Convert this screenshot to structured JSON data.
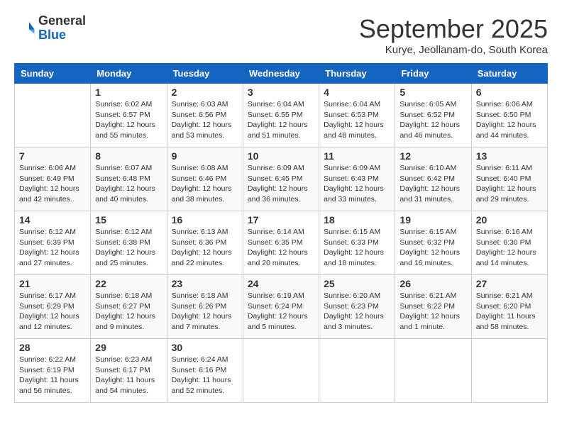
{
  "header": {
    "logo_general": "General",
    "logo_blue": "Blue",
    "month_title": "September 2025",
    "subtitle": "Kurye, Jeollanam-do, South Korea"
  },
  "days_of_week": [
    "Sunday",
    "Monday",
    "Tuesday",
    "Wednesday",
    "Thursday",
    "Friday",
    "Saturday"
  ],
  "weeks": [
    [
      {
        "day": "",
        "info": ""
      },
      {
        "day": "1",
        "info": "Sunrise: 6:02 AM\nSunset: 6:57 PM\nDaylight: 12 hours and 55 minutes."
      },
      {
        "day": "2",
        "info": "Sunrise: 6:03 AM\nSunset: 6:56 PM\nDaylight: 12 hours and 53 minutes."
      },
      {
        "day": "3",
        "info": "Sunrise: 6:04 AM\nSunset: 6:55 PM\nDaylight: 12 hours and 51 minutes."
      },
      {
        "day": "4",
        "info": "Sunrise: 6:04 AM\nSunset: 6:53 PM\nDaylight: 12 hours and 48 minutes."
      },
      {
        "day": "5",
        "info": "Sunrise: 6:05 AM\nSunset: 6:52 PM\nDaylight: 12 hours and 46 minutes."
      },
      {
        "day": "6",
        "info": "Sunrise: 6:06 AM\nSunset: 6:50 PM\nDaylight: 12 hours and 44 minutes."
      }
    ],
    [
      {
        "day": "7",
        "info": "Sunrise: 6:06 AM\nSunset: 6:49 PM\nDaylight: 12 hours and 42 minutes."
      },
      {
        "day": "8",
        "info": "Sunrise: 6:07 AM\nSunset: 6:48 PM\nDaylight: 12 hours and 40 minutes."
      },
      {
        "day": "9",
        "info": "Sunrise: 6:08 AM\nSunset: 6:46 PM\nDaylight: 12 hours and 38 minutes."
      },
      {
        "day": "10",
        "info": "Sunrise: 6:09 AM\nSunset: 6:45 PM\nDaylight: 12 hours and 36 minutes."
      },
      {
        "day": "11",
        "info": "Sunrise: 6:09 AM\nSunset: 6:43 PM\nDaylight: 12 hours and 33 minutes."
      },
      {
        "day": "12",
        "info": "Sunrise: 6:10 AM\nSunset: 6:42 PM\nDaylight: 12 hours and 31 minutes."
      },
      {
        "day": "13",
        "info": "Sunrise: 6:11 AM\nSunset: 6:40 PM\nDaylight: 12 hours and 29 minutes."
      }
    ],
    [
      {
        "day": "14",
        "info": "Sunrise: 6:12 AM\nSunset: 6:39 PM\nDaylight: 12 hours and 27 minutes."
      },
      {
        "day": "15",
        "info": "Sunrise: 6:12 AM\nSunset: 6:38 PM\nDaylight: 12 hours and 25 minutes."
      },
      {
        "day": "16",
        "info": "Sunrise: 6:13 AM\nSunset: 6:36 PM\nDaylight: 12 hours and 22 minutes."
      },
      {
        "day": "17",
        "info": "Sunrise: 6:14 AM\nSunset: 6:35 PM\nDaylight: 12 hours and 20 minutes."
      },
      {
        "day": "18",
        "info": "Sunrise: 6:15 AM\nSunset: 6:33 PM\nDaylight: 12 hours and 18 minutes."
      },
      {
        "day": "19",
        "info": "Sunrise: 6:15 AM\nSunset: 6:32 PM\nDaylight: 12 hours and 16 minutes."
      },
      {
        "day": "20",
        "info": "Sunrise: 6:16 AM\nSunset: 6:30 PM\nDaylight: 12 hours and 14 minutes."
      }
    ],
    [
      {
        "day": "21",
        "info": "Sunrise: 6:17 AM\nSunset: 6:29 PM\nDaylight: 12 hours and 12 minutes."
      },
      {
        "day": "22",
        "info": "Sunrise: 6:18 AM\nSunset: 6:27 PM\nDaylight: 12 hours and 9 minutes."
      },
      {
        "day": "23",
        "info": "Sunrise: 6:18 AM\nSunset: 6:26 PM\nDaylight: 12 hours and 7 minutes."
      },
      {
        "day": "24",
        "info": "Sunrise: 6:19 AM\nSunset: 6:24 PM\nDaylight: 12 hours and 5 minutes."
      },
      {
        "day": "25",
        "info": "Sunrise: 6:20 AM\nSunset: 6:23 PM\nDaylight: 12 hours and 3 minutes."
      },
      {
        "day": "26",
        "info": "Sunrise: 6:21 AM\nSunset: 6:22 PM\nDaylight: 12 hours and 1 minute."
      },
      {
        "day": "27",
        "info": "Sunrise: 6:21 AM\nSunset: 6:20 PM\nDaylight: 11 hours and 58 minutes."
      }
    ],
    [
      {
        "day": "28",
        "info": "Sunrise: 6:22 AM\nSunset: 6:19 PM\nDaylight: 11 hours and 56 minutes."
      },
      {
        "day": "29",
        "info": "Sunrise: 6:23 AM\nSunset: 6:17 PM\nDaylight: 11 hours and 54 minutes."
      },
      {
        "day": "30",
        "info": "Sunrise: 6:24 AM\nSunset: 6:16 PM\nDaylight: 11 hours and 52 minutes."
      },
      {
        "day": "",
        "info": ""
      },
      {
        "day": "",
        "info": ""
      },
      {
        "day": "",
        "info": ""
      },
      {
        "day": "",
        "info": ""
      }
    ]
  ]
}
